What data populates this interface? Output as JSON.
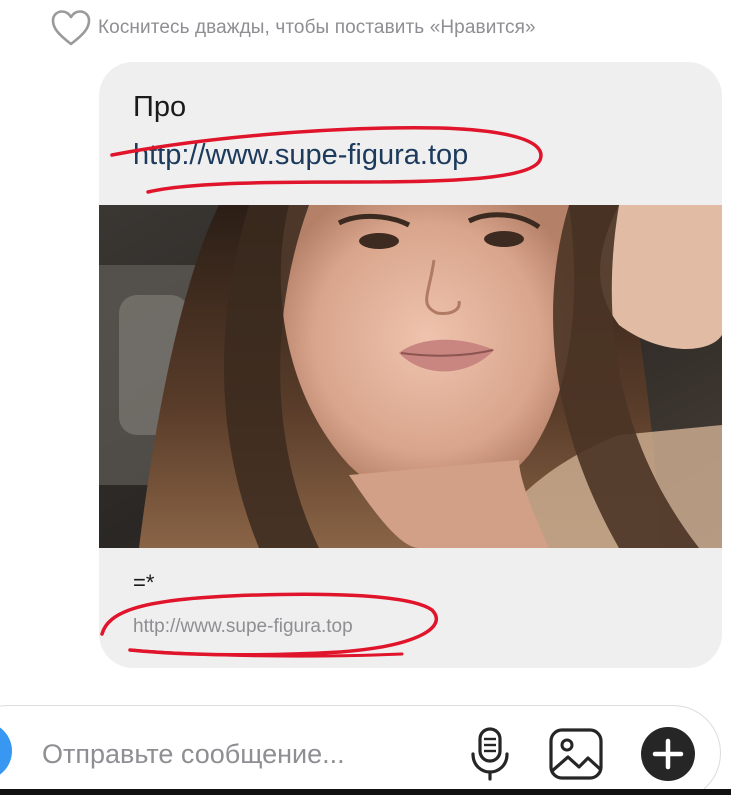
{
  "hint": {
    "icon": "heart-outline-icon",
    "text": "Коснитесь дважды, чтобы поставить «Нравится»"
  },
  "message": {
    "text": "Про",
    "link": "http://www.supe-figura.top",
    "preview": {
      "image": "portrait-photo",
      "title": "=*",
      "domain": "http://www.supe-figura.top"
    }
  },
  "composer": {
    "placeholder": "Отправьте сообщение...",
    "icons": [
      "camera-icon",
      "microphone-icon",
      "gallery-icon",
      "plus-icon"
    ]
  },
  "colors": {
    "bubble": "#efefef",
    "link": "#1b3a5c",
    "annotation": "#e0152b",
    "accent": "#3897f0",
    "muted_text": "#8e8e93"
  }
}
